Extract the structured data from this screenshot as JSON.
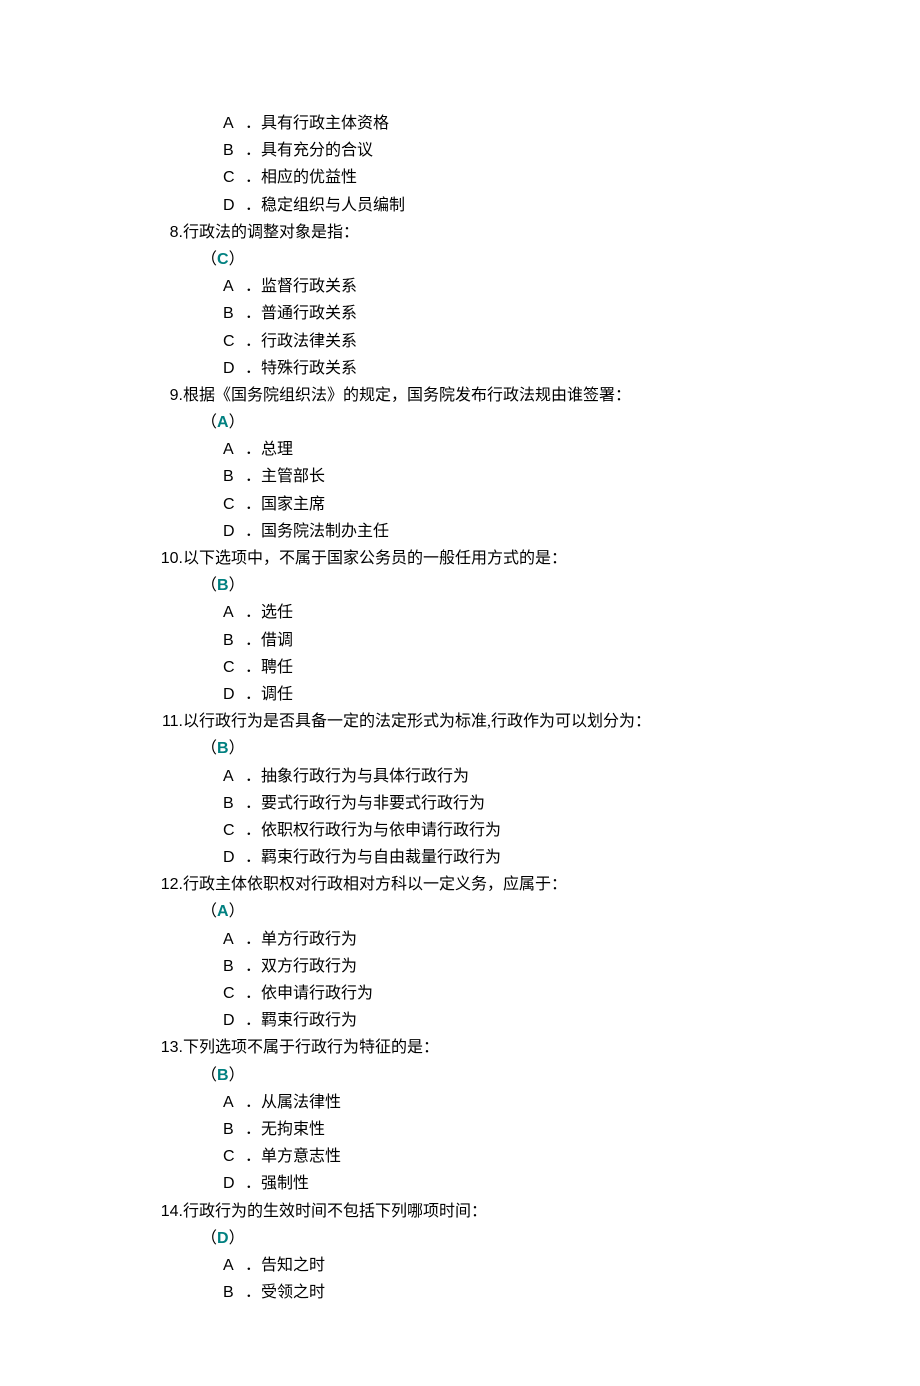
{
  "questions": [
    {
      "num": "",
      "stem": "",
      "answer": "",
      "options": [
        {
          "letter": "A",
          "text": "具有行政主体资格"
        },
        {
          "letter": "B",
          "text": "具有充分的合议"
        },
        {
          "letter": "C",
          "text": "相应的优益性"
        },
        {
          "letter": "D",
          "text": "稳定组织与人员编制"
        }
      ]
    },
    {
      "num": "8.",
      "stem": "行政法的调整对象是指：",
      "answer": "C",
      "options": [
        {
          "letter": "A",
          "text": "监督行政关系"
        },
        {
          "letter": "B",
          "text": "普通行政关系"
        },
        {
          "letter": "C",
          "text": "行政法律关系"
        },
        {
          "letter": "D",
          "text": "特殊行政关系"
        }
      ]
    },
    {
      "num": "9.",
      "stem": "根据《国务院组织法》的规定，国务院发布行政法规由谁签署：",
      "answer": "A",
      "options": [
        {
          "letter": "A",
          "text": "总理"
        },
        {
          "letter": "B",
          "text": "主管部长"
        },
        {
          "letter": "C",
          "text": "国家主席"
        },
        {
          "letter": "D",
          "text": "国务院法制办主任"
        }
      ]
    },
    {
      "num": "10.",
      "stem": "以下选项中，不属于国家公务员的一般任用方式的是：",
      "answer": "B",
      "options": [
        {
          "letter": "A",
          "text": "选任"
        },
        {
          "letter": "B",
          "text": "借调"
        },
        {
          "letter": "C",
          "text": "聘任"
        },
        {
          "letter": "D",
          "text": "调任"
        }
      ]
    },
    {
      "num": "11.",
      "stem": "以行政行为是否具备一定的法定形式为标准,行政作为可以划分为：",
      "answer": "B",
      "options": [
        {
          "letter": "A",
          "text": "抽象行政行为与具体行政行为"
        },
        {
          "letter": "B",
          "text": "要式行政行为与非要式行政行为"
        },
        {
          "letter": "C",
          "text": "依职权行政行为与依申请行政行为"
        },
        {
          "letter": "D",
          "text": "羁束行政行为与自由裁量行政行为"
        }
      ]
    },
    {
      "num": "12.",
      "stem": "行政主体依职权对行政相对方科以一定义务，应属于：",
      "answer": "A",
      "options": [
        {
          "letter": "A",
          "text": "单方行政行为"
        },
        {
          "letter": "B",
          "text": "双方行政行为"
        },
        {
          "letter": "C",
          "text": "依申请行政行为"
        },
        {
          "letter": "D",
          "text": "羁束行政行为"
        }
      ]
    },
    {
      "num": "13.",
      "stem": "下列选项不属于行政行为特征的是：",
      "answer": "B",
      "options": [
        {
          "letter": "A",
          "text": "从属法律性"
        },
        {
          "letter": "B",
          "text": "无拘束性"
        },
        {
          "letter": "C",
          "text": "单方意志性"
        },
        {
          "letter": "D",
          "text": "强制性"
        }
      ]
    },
    {
      "num": "14.",
      "stem": "行政行为的生效时间不包括下列哪项时间：",
      "answer": "D",
      "options": [
        {
          "letter": "A",
          "text": "告知之时"
        },
        {
          "letter": "B",
          "text": "受领之时"
        }
      ]
    }
  ],
  "paren_open": "（",
  "paren_close": "）",
  "period": "．"
}
